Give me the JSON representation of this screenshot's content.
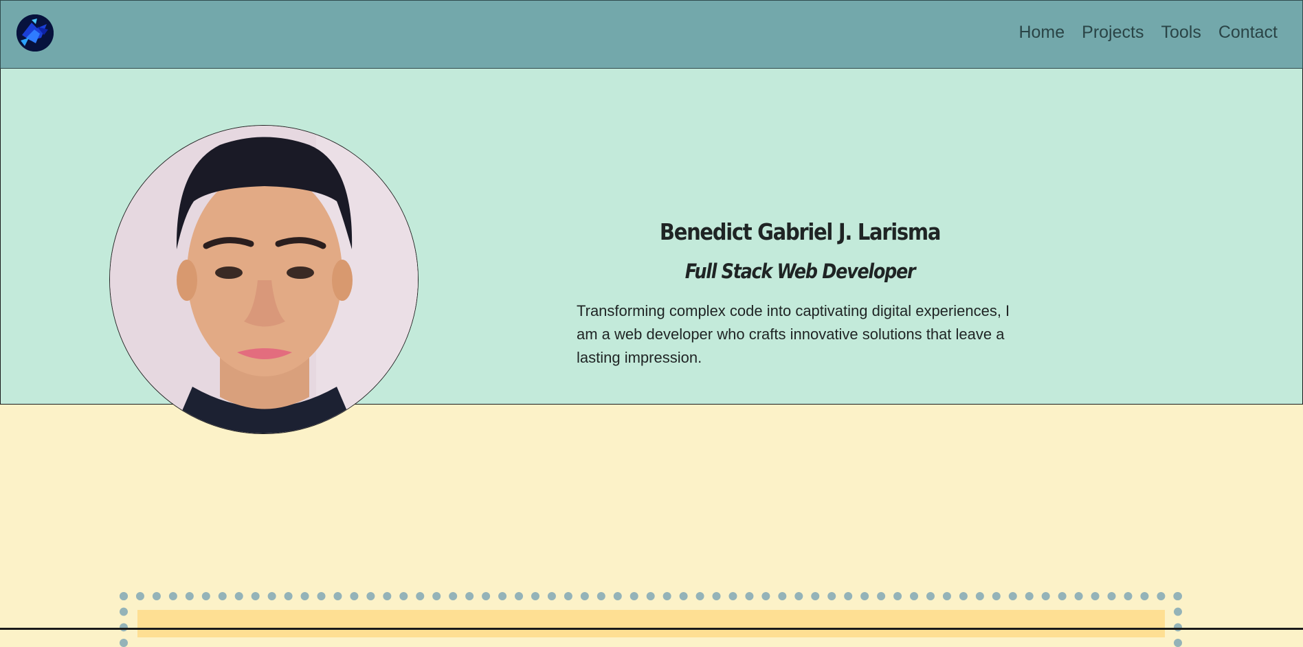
{
  "nav": {
    "logo_alt": "site logo",
    "links": [
      {
        "label": "Home"
      },
      {
        "label": "Projects"
      },
      {
        "label": "Tools"
      },
      {
        "label": "Contact"
      }
    ]
  },
  "hero": {
    "name": "Benedict Gabriel J. Larisma",
    "role": "Full Stack Web Developer",
    "bio": "Transforming complex code into captivating digital experiences, I am a web developer who crafts innovative solutions that leave a lasting impression."
  },
  "colors": {
    "navbar_bg": "#73a8ab",
    "hero_bg": "#c3eada",
    "page_bg": "#fcf2c8",
    "dotted_border": "#94b3b8",
    "panel_bg": "#fedf93",
    "text": "#1f2424"
  }
}
